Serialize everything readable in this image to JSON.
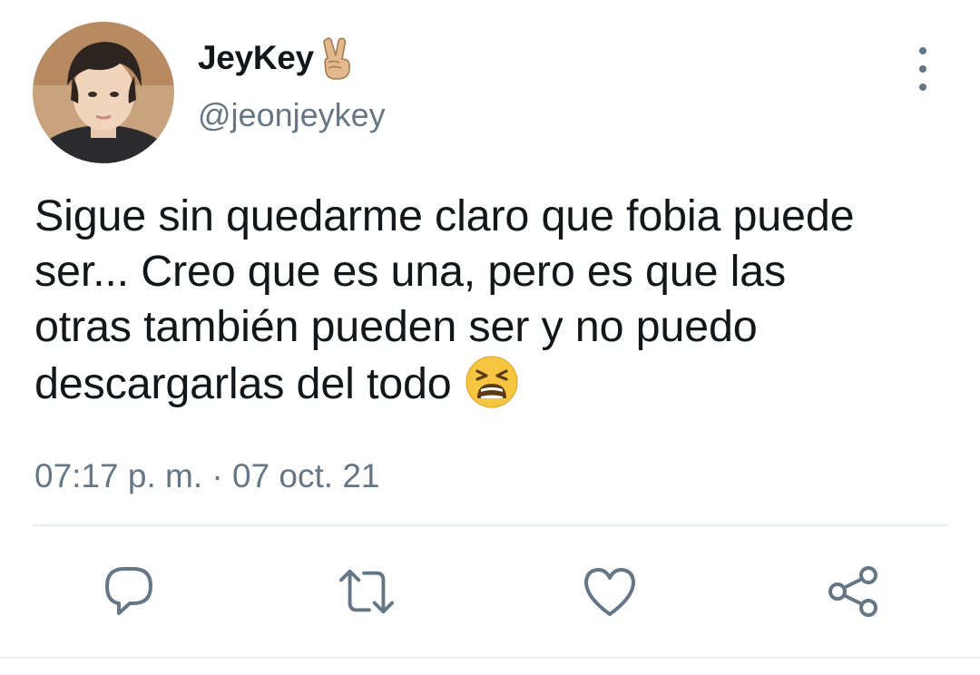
{
  "user": {
    "display_name": "JeyKey",
    "name_emoji": "victory-hand-emoji",
    "handle": "@jeonjeykey",
    "avatar": "profile-photo"
  },
  "tweet": {
    "lines": [
      "Sigue sin quedarme claro que fobia puede",
      "ser... Creo que es una, pero es que las",
      "otras también pueden ser y no puedo",
      "descargarlas del todo"
    ],
    "trailing_emoji": "tired-face-emoji",
    "timestamp": "07:17 p. m. · 07 oct. 21"
  },
  "actions": {
    "icons": [
      "reply-icon",
      "retweet-icon",
      "like-icon",
      "share-icon"
    ]
  },
  "colors": {
    "text": "#14171a",
    "secondary": "#657786",
    "divider": "#e6ecf0"
  }
}
